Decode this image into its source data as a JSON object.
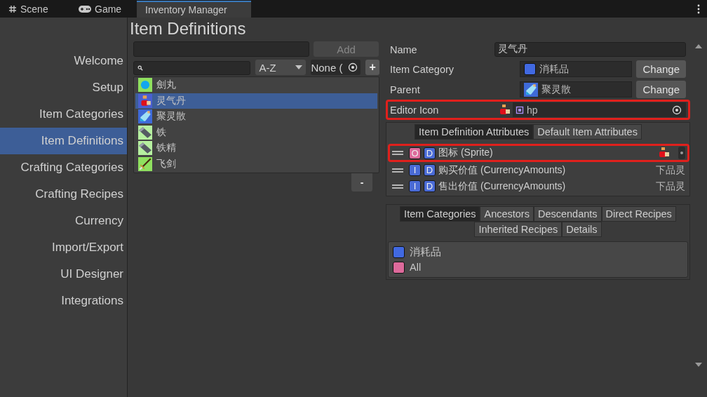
{
  "tabs": [
    {
      "label": "Scene",
      "selected": false
    },
    {
      "label": "Game",
      "selected": false
    },
    {
      "label": "Inventory Manager",
      "selected": true
    }
  ],
  "title": "Item Definitions",
  "sidebar": {
    "items": [
      {
        "label": "Welcome",
        "selected": false
      },
      {
        "label": "Setup",
        "selected": false
      },
      {
        "label": "Item Categories",
        "selected": false
      },
      {
        "label": "Item Definitions",
        "selected": true
      },
      {
        "label": "Crafting Categories",
        "selected": false
      },
      {
        "label": "Crafting Recipes",
        "selected": false
      },
      {
        "label": "Currency",
        "selected": false
      },
      {
        "label": "Import/Export",
        "selected": false
      },
      {
        "label": "UI Designer",
        "selected": false
      },
      {
        "label": "Integrations",
        "selected": false
      }
    ]
  },
  "definition_list": {
    "add_button": "Add",
    "sort": "A-Z",
    "filter": "None (",
    "add_icon": "+",
    "remove_button": "-",
    "items": [
      {
        "name": "劍丸",
        "kind": "orb",
        "selected": false
      },
      {
        "name": "灵气丹",
        "kind": "potion",
        "selected": true
      },
      {
        "name": "聚灵散",
        "kind": "flask",
        "selected": false
      },
      {
        "name": "铁",
        "kind": "ingot",
        "selected": false
      },
      {
        "name": "铁精",
        "kind": "ingot",
        "selected": false
      },
      {
        "name": "飞剑",
        "kind": "sword",
        "selected": false
      }
    ]
  },
  "details": {
    "fields": [
      {
        "label": "Name",
        "kind": "text",
        "value": "灵气丹",
        "highlighted": false
      },
      {
        "label": "Item Category",
        "kind": "category",
        "value": "消耗品",
        "color": "#4169e1",
        "button": "Change",
        "highlighted": false
      },
      {
        "label": "Parent",
        "kind": "item",
        "value": "聚灵散",
        "button": "Change",
        "highlighted": false
      },
      {
        "label": "Editor Icon",
        "kind": "sprite",
        "value": "hp",
        "highlighted": true
      }
    ],
    "attribute_tabs": [
      {
        "label": "Item Definition Attributes",
        "selected": true
      },
      {
        "label": "Default Item Attributes",
        "selected": false
      }
    ],
    "attributes": [
      {
        "badges": [
          {
            "letter": "O",
            "color": "#dd6a9b"
          },
          {
            "letter": "D",
            "color": "#4a6bd6"
          }
        ],
        "name": "图标 (Sprite)",
        "kind": "sprite",
        "highlighted": true
      },
      {
        "badges": [
          {
            "letter": "I",
            "color": "#4a6bd6"
          },
          {
            "letter": "D",
            "color": "#4a6bd6"
          }
        ],
        "name": "购买价值 (CurrencyAmounts)",
        "kind": "text",
        "value": "下品灵",
        "highlighted": false
      },
      {
        "badges": [
          {
            "letter": "I",
            "color": "#4a6bd6"
          },
          {
            "letter": "D",
            "color": "#4a6bd6"
          }
        ],
        "name": "售出价值 (CurrencyAmounts)",
        "kind": "text",
        "value": "下品灵",
        "highlighted": false
      }
    ],
    "relation_tabs": [
      {
        "label": "Item Categories",
        "selected": true
      },
      {
        "label": "Ancestors",
        "selected": false
      },
      {
        "label": "Descendants",
        "selected": false
      },
      {
        "label": "Direct Recipes",
        "selected": false
      },
      {
        "label": "Inherited Recipes",
        "selected": false
      },
      {
        "label": "Details",
        "selected": false
      }
    ],
    "categories": [
      {
        "name": "消耗品",
        "color": "#4169e1"
      },
      {
        "name": "All",
        "color": "#dd6a9b"
      }
    ]
  }
}
